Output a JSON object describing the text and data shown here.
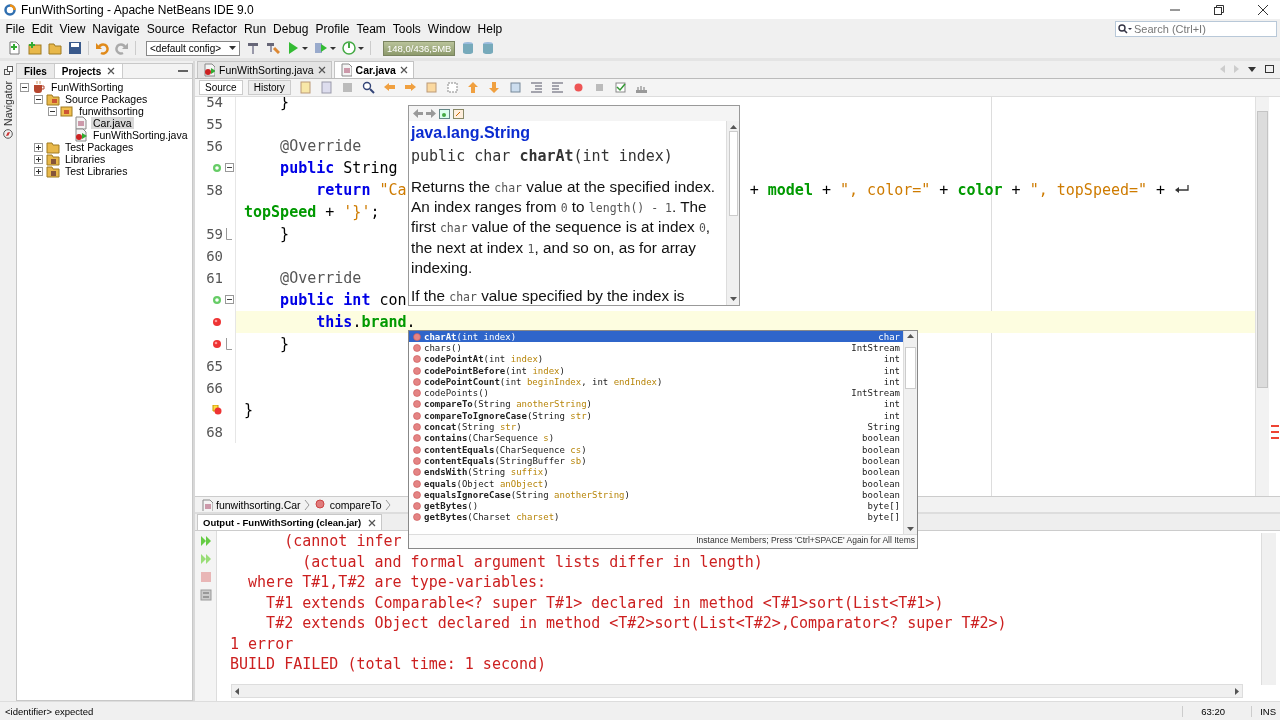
{
  "window": {
    "title": "FunWithSorting - Apache NetBeans IDE 9.0"
  },
  "menu": [
    "File",
    "Edit",
    "View",
    "Navigate",
    "Source",
    "Refactor",
    "Run",
    "Debug",
    "Profile",
    "Team",
    "Tools",
    "Window",
    "Help"
  ],
  "search": {
    "placeholder": "Search (Ctrl+I)"
  },
  "toolbar": {
    "config": "<default config>",
    "memory": "148,0/436,5MB"
  },
  "navigator": {
    "label": "Navigator"
  },
  "side_tabs": [
    {
      "label": "Files",
      "selected": false
    },
    {
      "label": "Projects",
      "selected": true
    }
  ],
  "project_tree": [
    {
      "label": "FunWithSorting",
      "kind": "project",
      "expanded": true,
      "selected": false,
      "children": [
        {
          "label": "Source Packages",
          "kind": "source-folder",
          "expanded": true,
          "selected": false,
          "children": [
            {
              "label": "funwithsorting",
              "kind": "package",
              "expanded": true,
              "selected": false,
              "children": [
                {
                  "label": "Car.java",
                  "kind": "class",
                  "selected": true
                },
                {
                  "label": "FunWithSorting.java",
                  "kind": "main-class",
                  "selected": false
                }
              ]
            }
          ]
        },
        {
          "label": "Test Packages",
          "kind": "test-folder",
          "expanded": false,
          "selected": false
        },
        {
          "label": "Libraries",
          "kind": "library",
          "expanded": false,
          "selected": false
        },
        {
          "label": "Test Libraries",
          "kind": "library",
          "expanded": false,
          "selected": false
        }
      ]
    }
  ],
  "editor_tabs": [
    {
      "label": "FunWithSorting.java",
      "kind": "main-class",
      "selected": false
    },
    {
      "label": "Car.java",
      "kind": "class",
      "selected": true
    }
  ],
  "view_tabs": [
    {
      "label": "Source",
      "selected": true
    },
    {
      "label": "History",
      "selected": false
    }
  ],
  "code_lines": [
    {
      "kind": "numbered",
      "number": "54",
      "current": false,
      "fold_start": false,
      "fold_end": false,
      "wrapped": false,
      "tokens": [
        {
          "text": "    }",
          "kind": "plain"
        }
      ]
    },
    {
      "kind": "numbered",
      "number": "55",
      "current": false,
      "fold_start": false,
      "fold_end": false,
      "wrapped": false
    },
    {
      "kind": "numbered",
      "number": "56",
      "current": false,
      "fold_start": false,
      "fold_end": false,
      "wrapped": false,
      "tokens": [
        {
          "text": "    @Override",
          "kind": "annotation"
        }
      ]
    },
    {
      "kind": "override",
      "current": false,
      "fold_start": true,
      "fold_end": false,
      "wrapped": false,
      "tokens": [
        {
          "text": "    public",
          "kind": "keyword"
        },
        {
          "text": " String",
          "kind": "plain"
        }
      ]
    },
    {
      "kind": "numbered",
      "number": "58",
      "current": false,
      "fold_start": false,
      "fold_end": false,
      "wrapped": true,
      "tokens": [
        {
          "text": "        return",
          "kind": "keyword"
        },
        {
          "text": " \"Ca",
          "kind": "string"
        }
      ],
      "tokens_right": [
        {
          "text": "+ ",
          "kind": "plain"
        },
        {
          "text": "model",
          "kind": "field"
        },
        {
          "text": " + ",
          "kind": "plain"
        },
        {
          "text": "\", color=\"",
          "kind": "string"
        },
        {
          "text": " + ",
          "kind": "plain"
        },
        {
          "text": "color",
          "kind": "field"
        },
        {
          "text": " + ",
          "kind": "plain"
        },
        {
          "text": "\", topSpeed=\"",
          "kind": "string"
        },
        {
          "text": " +",
          "kind": "plain"
        }
      ]
    },
    {
      "kind": "continuation",
      "current": false,
      "fold_start": false,
      "fold_end": false,
      "wrapped": false,
      "tokens": [
        {
          "text": "topSpeed",
          "kind": "field"
        },
        {
          "text": " + ",
          "kind": "plain"
        },
        {
          "text": "'}'",
          "kind": "string"
        },
        {
          "text": ";",
          "kind": "plain"
        }
      ]
    },
    {
      "kind": "numbered",
      "number": "59",
      "current": false,
      "fold_start": false,
      "fold_end": true,
      "wrapped": false,
      "tokens": [
        {
          "text": "    }",
          "kind": "plain"
        }
      ]
    },
    {
      "kind": "numbered",
      "number": "60",
      "current": false,
      "fold_start": false,
      "fold_end": false,
      "wrapped": false
    },
    {
      "kind": "numbered",
      "number": "61",
      "current": false,
      "fold_start": false,
      "fold_end": false,
      "wrapped": false,
      "tokens": [
        {
          "text": "    @Override",
          "kind": "annotation"
        }
      ]
    },
    {
      "kind": "override",
      "current": false,
      "fold_start": true,
      "fold_end": false,
      "wrapped": false,
      "tokens": [
        {
          "text": "    public",
          "kind": "keyword"
        },
        {
          "text": " int",
          "kind": "keyword"
        },
        {
          "text": " con",
          "kind": "plain"
        }
      ]
    },
    {
      "kind": "error",
      "current": true,
      "fold_start": false,
      "fold_end": false,
      "wrapped": false,
      "tokens": [
        {
          "text": "        this",
          "kind": "keyword"
        },
        {
          "text": ".",
          "kind": "plain"
        },
        {
          "text": "brand",
          "kind": "field"
        },
        {
          "text": ".",
          "kind": "plain"
        }
      ]
    },
    {
      "kind": "error",
      "current": false,
      "fold_start": false,
      "fold_end": true,
      "wrapped": false,
      "tokens": [
        {
          "text": "    }",
          "kind": "plain"
        }
      ]
    },
    {
      "kind": "numbered",
      "number": "65",
      "current": false,
      "fold_start": false,
      "fold_end": false,
      "wrapped": false
    },
    {
      "kind": "numbered",
      "number": "66",
      "current": false,
      "fold_start": false,
      "fold_end": false,
      "wrapped": false
    },
    {
      "kind": "error-hint",
      "current": false,
      "fold_start": false,
      "fold_end": false,
      "wrapped": false,
      "tokens": [
        {
          "text": "}",
          "kind": "plain"
        }
      ]
    },
    {
      "kind": "numbered",
      "number": "68",
      "current": false,
      "fold_start": false,
      "fold_end": false,
      "wrapped": false
    }
  ],
  "breadcrumbs": [
    {
      "label": "funwithsorting.Car",
      "kind": "class"
    },
    {
      "label": "compareTo",
      "kind": "method"
    }
  ],
  "output": {
    "tab": "Output - FunWithSorting (clean.jar)",
    "lines": [
      "      (cannot infer",
      "        (actual and formal argument lists differ in length)",
      "  where T#1,T#2 are type-variables:",
      "    T#1 extends Comparable<? super T#1> declared in method <T#1>sort(List<T#1>)",
      "    T#2 extends Object declared in method <T#2>sort(List<T#2>,Comparator<? super T#2>)",
      "1 error",
      "BUILD FAILED (total time: 1 second)"
    ]
  },
  "javadoc": {
    "title": "java.lang.String",
    "signature": "public char **charAt**(int index)",
    "paragraphs": [
      [
        {
          "text": "Returns the ",
          "kind": "plain"
        },
        {
          "text": "char",
          "kind": "code"
        },
        {
          "text": " value at the specified index. An index ranges from ",
          "kind": "plain"
        },
        {
          "text": "0",
          "kind": "code"
        },
        {
          "text": " to ",
          "kind": "plain"
        },
        {
          "text": "length() - 1",
          "kind": "code"
        },
        {
          "text": ". The first ",
          "kind": "plain"
        },
        {
          "text": "char",
          "kind": "code"
        },
        {
          "text": " value of the sequence is at index ",
          "kind": "plain"
        },
        {
          "text": "0",
          "kind": "code"
        },
        {
          "text": ", the next at index ",
          "kind": "plain"
        },
        {
          "text": "1",
          "kind": "code"
        },
        {
          "text": ", and so on, as for array indexing.",
          "kind": "plain"
        }
      ],
      [
        {
          "text": "If the ",
          "kind": "plain"
        },
        {
          "text": "char",
          "kind": "code"
        },
        {
          "text": " value specified by the index is",
          "kind": "plain"
        }
      ]
    ]
  },
  "completion": {
    "items": [
      {
        "selected": true,
        "returns": "char",
        "parts": [
          {
            "text": "charAt",
            "kind": "name"
          },
          {
            "text": "(int ",
            "kind": "plain"
          },
          {
            "text": "index",
            "kind": "param"
          },
          {
            "text": ")",
            "kind": "plain"
          }
        ]
      },
      {
        "selected": false,
        "returns": "IntStream",
        "parts": [
          {
            "text": "chars",
            "kind": "inherited"
          },
          {
            "text": "()",
            "kind": "plain"
          }
        ]
      },
      {
        "selected": false,
        "returns": "int",
        "parts": [
          {
            "text": "codePointAt",
            "kind": "name"
          },
          {
            "text": "(int ",
            "kind": "plain"
          },
          {
            "text": "index",
            "kind": "param"
          },
          {
            "text": ")",
            "kind": "plain"
          }
        ]
      },
      {
        "selected": false,
        "returns": "int",
        "parts": [
          {
            "text": "codePointBefore",
            "kind": "name"
          },
          {
            "text": "(int ",
            "kind": "plain"
          },
          {
            "text": "index",
            "kind": "param"
          },
          {
            "text": ")",
            "kind": "plain"
          }
        ]
      },
      {
        "selected": false,
        "returns": "int",
        "parts": [
          {
            "text": "codePointCount",
            "kind": "name"
          },
          {
            "text": "(int ",
            "kind": "plain"
          },
          {
            "text": "beginIndex",
            "kind": "param"
          },
          {
            "text": ", int ",
            "kind": "plain"
          },
          {
            "text": "endIndex",
            "kind": "param"
          },
          {
            "text": ")",
            "kind": "plain"
          }
        ]
      },
      {
        "selected": false,
        "returns": "IntStream",
        "parts": [
          {
            "text": "codePoints",
            "kind": "inherited"
          },
          {
            "text": "()",
            "kind": "plain"
          }
        ]
      },
      {
        "selected": false,
        "returns": "int",
        "parts": [
          {
            "text": "compareTo",
            "kind": "name"
          },
          {
            "text": "(String ",
            "kind": "plain"
          },
          {
            "text": "anotherString",
            "kind": "param"
          },
          {
            "text": ")",
            "kind": "plain"
          }
        ]
      },
      {
        "selected": false,
        "returns": "int",
        "parts": [
          {
            "text": "compareToIgnoreCase",
            "kind": "name"
          },
          {
            "text": "(String ",
            "kind": "plain"
          },
          {
            "text": "str",
            "kind": "param"
          },
          {
            "text": ")",
            "kind": "plain"
          }
        ]
      },
      {
        "selected": false,
        "returns": "String",
        "parts": [
          {
            "text": "concat",
            "kind": "name"
          },
          {
            "text": "(String ",
            "kind": "plain"
          },
          {
            "text": "str",
            "kind": "param"
          },
          {
            "text": ")",
            "kind": "plain"
          }
        ]
      },
      {
        "selected": false,
        "returns": "boolean",
        "parts": [
          {
            "text": "contains",
            "kind": "name"
          },
          {
            "text": "(CharSequence ",
            "kind": "plain"
          },
          {
            "text": "s",
            "kind": "param"
          },
          {
            "text": ")",
            "kind": "plain"
          }
        ]
      },
      {
        "selected": false,
        "returns": "boolean",
        "parts": [
          {
            "text": "contentEquals",
            "kind": "name"
          },
          {
            "text": "(CharSequence ",
            "kind": "plain"
          },
          {
            "text": "cs",
            "kind": "param"
          },
          {
            "text": ")",
            "kind": "plain"
          }
        ]
      },
      {
        "selected": false,
        "returns": "boolean",
        "parts": [
          {
            "text": "contentEquals",
            "kind": "name"
          },
          {
            "text": "(StringBuffer ",
            "kind": "plain"
          },
          {
            "text": "sb",
            "kind": "param"
          },
          {
            "text": ")",
            "kind": "plain"
          }
        ]
      },
      {
        "selected": false,
        "returns": "boolean",
        "parts": [
          {
            "text": "endsWith",
            "kind": "name"
          },
          {
            "text": "(String ",
            "kind": "plain"
          },
          {
            "text": "suffix",
            "kind": "param"
          },
          {
            "text": ")",
            "kind": "plain"
          }
        ]
      },
      {
        "selected": false,
        "returns": "boolean",
        "parts": [
          {
            "text": "equals",
            "kind": "name"
          },
          {
            "text": "(Object ",
            "kind": "plain"
          },
          {
            "text": "anObject",
            "kind": "param"
          },
          {
            "text": ")",
            "kind": "plain"
          }
        ]
      },
      {
        "selected": false,
        "returns": "boolean",
        "parts": [
          {
            "text": "equalsIgnoreCase",
            "kind": "name"
          },
          {
            "text": "(String ",
            "kind": "plain"
          },
          {
            "text": "anotherString",
            "kind": "param"
          },
          {
            "text": ")",
            "kind": "plain"
          }
        ]
      },
      {
        "selected": false,
        "returns": "byte[]",
        "parts": [
          {
            "text": "getBytes",
            "kind": "name"
          },
          {
            "text": "()",
            "kind": "plain"
          }
        ]
      },
      {
        "selected": false,
        "returns": "byte[]",
        "parts": [
          {
            "text": "getBytes",
            "kind": "name"
          },
          {
            "text": "(Charset ",
            "kind": "plain"
          },
          {
            "text": "charset",
            "kind": "param"
          },
          {
            "text": ")",
            "kind": "plain"
          }
        ]
      }
    ],
    "footer": "Instance Members; Press 'Ctrl+SPACE' Again for All Items"
  },
  "status": {
    "message": "<identifier> expected",
    "position": "63:20",
    "mode": "INS"
  }
}
